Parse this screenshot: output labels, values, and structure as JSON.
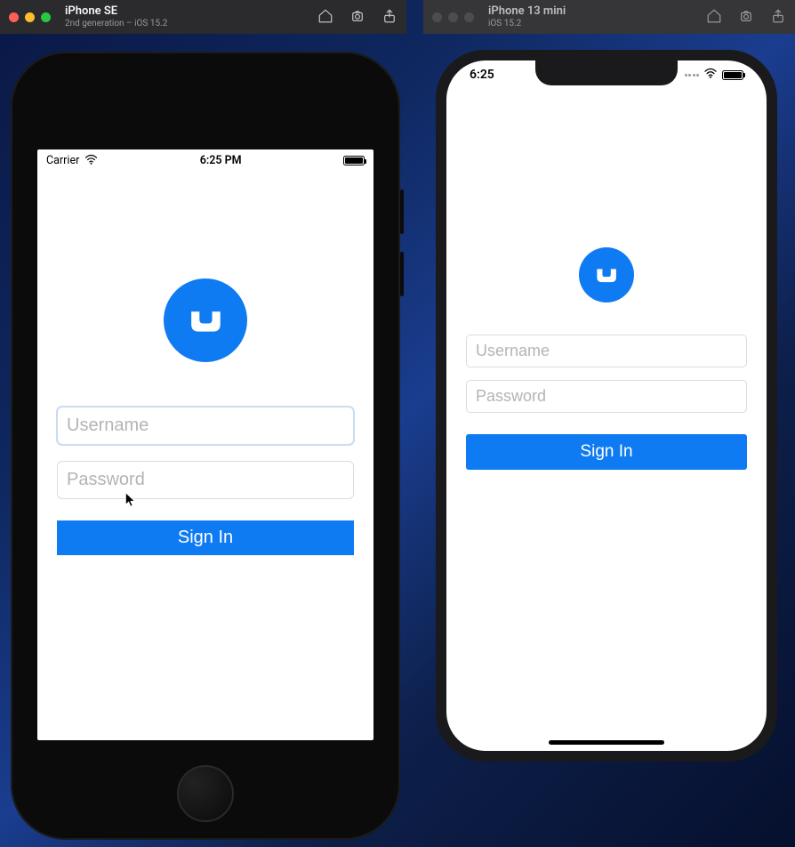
{
  "simulators": {
    "left": {
      "title": "iPhone SE",
      "subtitle": "2nd generation – iOS 15.2",
      "statusbar": {
        "carrier": "Carrier",
        "time": "6:25 PM"
      }
    },
    "right": {
      "title": "iPhone 13 mini",
      "subtitle": "iOS 15.2",
      "statusbar": {
        "time": "6:25"
      }
    }
  },
  "app": {
    "username_placeholder": "Username",
    "password_placeholder": "Password",
    "signin_label": "Sign In"
  }
}
